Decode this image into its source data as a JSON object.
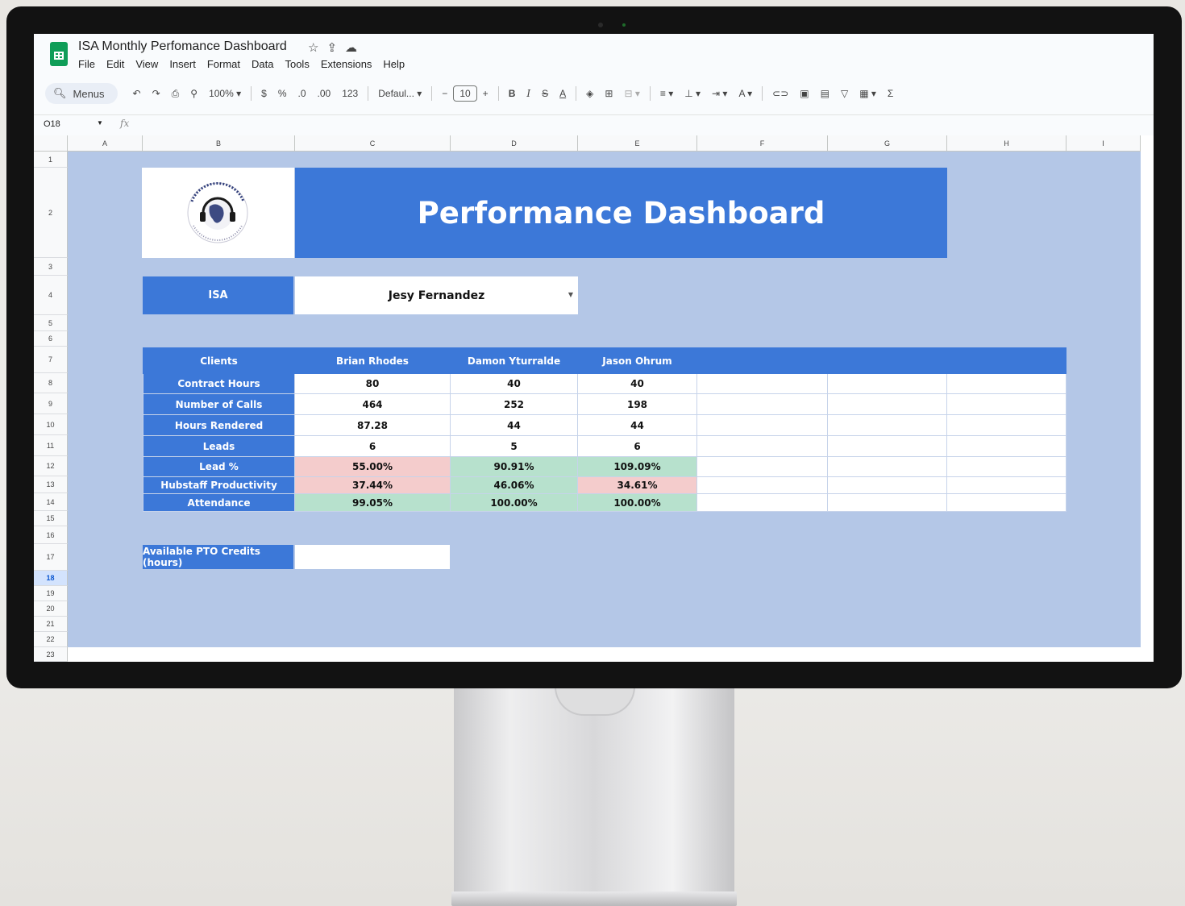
{
  "doc": {
    "title": "ISA Monthly Perfomance Dashboard",
    "menu": [
      "File",
      "Edit",
      "View",
      "Insert",
      "Format",
      "Data",
      "Tools",
      "Extensions",
      "Help"
    ]
  },
  "toolbar": {
    "search_label": "Menus",
    "zoom": "100%",
    "currency": "$",
    "percent": "%",
    "dec_decrease": ".0",
    "dec_increase": ".00",
    "number_format": "123",
    "font": "Defaul...",
    "font_size": "10"
  },
  "formula_bar": {
    "cell_ref": "O18",
    "fx": "fx"
  },
  "columns": [
    "A",
    "B",
    "C",
    "D",
    "E",
    "F",
    "G",
    "H",
    "I"
  ],
  "rows": [
    "1",
    "2",
    "3",
    "4",
    "5",
    "6",
    "7",
    "8",
    "9",
    "10",
    "11",
    "12",
    "13",
    "14",
    "15",
    "16",
    "17",
    "18",
    "19",
    "20",
    "21",
    "22",
    "23"
  ],
  "selected_row": "18",
  "banner_title": "Performance Dashboard",
  "isa": {
    "label": "ISA",
    "selected": "Jesy Fernandez"
  },
  "table": {
    "header": [
      "Clients",
      "Brian Rhodes",
      "Damon Yturralde",
      "Jason Ohrum",
      "",
      "",
      ""
    ],
    "rows": [
      {
        "label": "Contract Hours",
        "values": [
          "80",
          "40",
          "40"
        ],
        "status": [
          "",
          "",
          ""
        ]
      },
      {
        "label": "Number of Calls",
        "values": [
          "464",
          "252",
          "198"
        ],
        "status": [
          "",
          "",
          ""
        ]
      },
      {
        "label": "Hours Rendered",
        "values": [
          "87.28",
          "44",
          "44"
        ],
        "status": [
          "",
          "",
          ""
        ]
      },
      {
        "label": "Leads",
        "values": [
          "6",
          "5",
          "6"
        ],
        "status": [
          "",
          "",
          ""
        ]
      },
      {
        "label": "Lead %",
        "values": [
          "55.00%",
          "90.91%",
          "109.09%"
        ],
        "status": [
          "red",
          "green",
          "green"
        ]
      },
      {
        "label": "Hubstaff Productivity",
        "values": [
          "37.44%",
          "46.06%",
          "34.61%"
        ],
        "status": [
          "red",
          "green",
          "red"
        ]
      },
      {
        "label": "Attendance",
        "values": [
          "99.05%",
          "100.00%",
          "100.00%"
        ],
        "status": [
          "green",
          "green",
          "green"
        ]
      }
    ]
  },
  "pto": {
    "label": "Available PTO Credits (hours)",
    "value": ""
  },
  "colors": {
    "header_blue": "#3c78d8",
    "sheet_background": "#b4c7e7",
    "good": "#b7e1cd",
    "bad": "#f4cccc"
  }
}
